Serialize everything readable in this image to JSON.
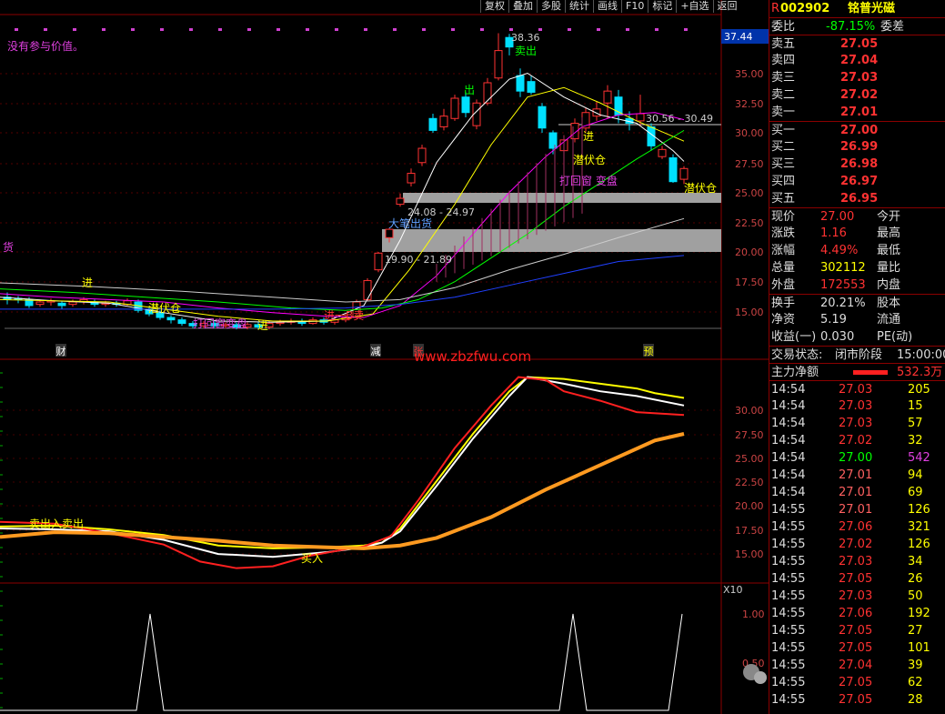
{
  "toolbar": [
    "复权",
    "叠加",
    "多股",
    "统计",
    "画线",
    "F10",
    "标记",
    "+自选",
    "返回"
  ],
  "stock": {
    "flag": "R",
    "code": "002902",
    "name": "铭普光磁"
  },
  "main_note": "没有参与价值。",
  "price_axis": [
    "37.44",
    "35.00",
    "32.50",
    "30.00",
    "27.50",
    "25.00",
    "22.50",
    "20.00",
    "17.50",
    "15.00"
  ],
  "ind_axis": [
    "30.00",
    "27.50",
    "25.00",
    "22.50",
    "20.00",
    "17.50",
    "15.00"
  ],
  "sub_axis": [
    "X10",
    "1.00",
    "0.50"
  ],
  "chart_labels": {
    "hi": "38.36",
    "mai1": "卖出",
    "chu": "出",
    "band1": "30.56 - 30.49",
    "jin1": "进",
    "qfc1": "潜伏仓",
    "qfc2": "潜伏仓",
    "dj": "打回窗 变盘",
    "z1": "24.08 - 24.97",
    "dzc": "大笔出货",
    "z2": "19.90 - 21.89",
    "qfc3": "潜伏仓",
    "jin2": "进",
    "dj2": "打回窗变盘",
    "jin3": "进",
    "mai2": "进一B卖",
    "huo": "货",
    "ind1": "卖出入卖出",
    "ind2": "买入"
  },
  "events": [
    "财",
    "减",
    "张",
    "预"
  ],
  "watermark": "www.zbzfwu.com",
  "wechat": "罚赢空指标所",
  "quote": {
    "wb": [
      "委比",
      "-87.15%",
      "委差"
    ],
    "asks": [
      [
        "卖五",
        "27.05"
      ],
      [
        "卖四",
        "27.04"
      ],
      [
        "卖三",
        "27.03"
      ],
      [
        "卖二",
        "27.02"
      ],
      [
        "卖一",
        "27.01"
      ]
    ],
    "bids": [
      [
        "买一",
        "27.00"
      ],
      [
        "买二",
        "26.99"
      ],
      [
        "买三",
        "26.98"
      ],
      [
        "买四",
        "26.97"
      ],
      [
        "买五",
        "26.95"
      ]
    ],
    "stats": [
      [
        "现价",
        "27.00",
        "今开"
      ],
      [
        "涨跌",
        "1.16",
        "最高"
      ],
      [
        "涨幅",
        "4.49%",
        "最低"
      ],
      [
        "总量",
        "302112",
        "量比"
      ],
      [
        "外盘",
        "172553",
        "内盘"
      ]
    ],
    "fin": [
      [
        "换手",
        "20.21%",
        "股本"
      ],
      [
        "净资",
        "5.19",
        "流通"
      ],
      [
        "收益(一)",
        "0.030",
        "PE(动)"
      ]
    ],
    "status": [
      "交易状态:",
      "闭市阶段",
      "15:00:00"
    ],
    "flow": [
      "主力净额",
      "532.3万"
    ],
    "ticks": [
      [
        "14:54",
        "27.03",
        "205"
      ],
      [
        "14:54",
        "27.03",
        "15"
      ],
      [
        "14:54",
        "27.03",
        "57"
      ],
      [
        "14:54",
        "27.02",
        "32"
      ],
      [
        "14:54",
        "27.00",
        "542"
      ],
      [
        "14:54",
        "27.01",
        "94"
      ],
      [
        "14:54",
        "27.01",
        "69"
      ],
      [
        "14:55",
        "27.01",
        "126"
      ],
      [
        "14:55",
        "27.06",
        "321"
      ],
      [
        "14:55",
        "27.02",
        "126"
      ],
      [
        "14:55",
        "27.03",
        "34"
      ],
      [
        "14:55",
        "27.05",
        "26"
      ],
      [
        "14:55",
        "27.03",
        "50"
      ],
      [
        "14:55",
        "27.06",
        "192"
      ],
      [
        "14:55",
        "27.05",
        "27"
      ],
      [
        "14:55",
        "27.05",
        "101"
      ],
      [
        "14:55",
        "27.04",
        "39"
      ],
      [
        "14:55",
        "27.05",
        "62"
      ],
      [
        "14:55",
        "27.05",
        "28"
      ]
    ]
  },
  "colors": {
    "up": "#ff3232",
    "down": "#00ffff",
    "axis": "#8b0000",
    "ma5": "#ffffff",
    "ma10": "#ffff00",
    "ma20": "#ff00ff",
    "ma60": "#00ff00",
    "ma120": "#cccccc",
    "ma250": "#0000ff"
  }
}
